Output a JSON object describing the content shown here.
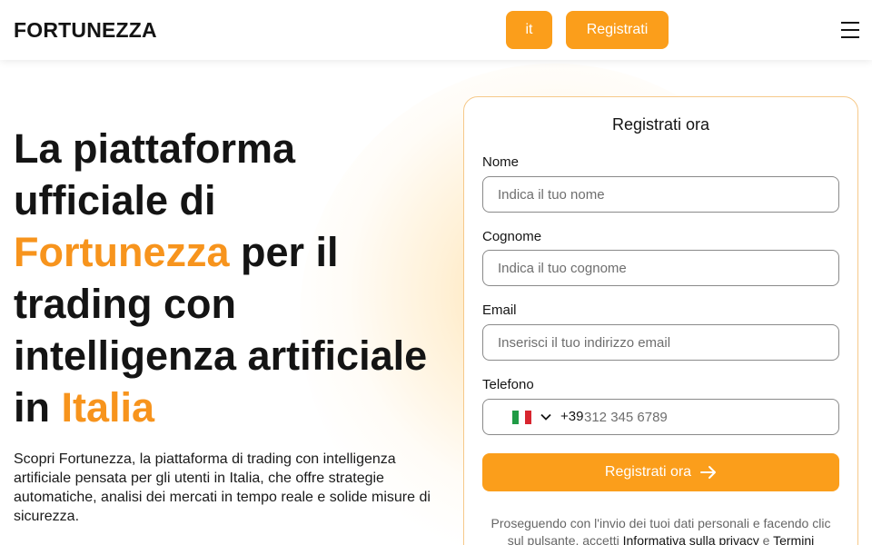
{
  "header": {
    "logo": "FORTUNEZZA",
    "lang_label": "it",
    "register_label": "Registrati",
    "menu_icon": "hamburger-menu-icon"
  },
  "hero": {
    "title_line1": "La piattaforma",
    "title_line2": "ufficiale di",
    "title_accent1": "Fortunezza",
    "title_line3_rest": " per il",
    "title_line4": "trading con",
    "title_line5": "intelligenza artificiale",
    "title_line6_start": "in ",
    "title_accent2": "Italia",
    "description": "Scopri Fortunezza, la piattaforma di trading con intelligenza artificiale pensata per gli utenti in Italia, che offre strategie automatiche, analisi dei mercati in tempo reale e solide misure di sicurezza."
  },
  "form": {
    "title": "Registrati ora",
    "first_name_label": "Nome",
    "first_name_placeholder": "Indica il tuo nome",
    "last_name_label": "Cognome",
    "last_name_placeholder": "Indica il tuo cognome",
    "email_label": "Email",
    "email_placeholder": "Inserisci il tuo indirizzo email",
    "phone_label": "Telefono",
    "phone_dial_code": "+39",
    "phone_placeholder": "312 345 6789",
    "phone_flag_icon": "italy-flag-icon",
    "submit_label": "Registrati ora",
    "consent_text": "Proseguendo con l'invio dei tuoi dati personali e facendo clic sul pulsante, accetti ",
    "privacy_link": "Informativa sulla privacy",
    "consent_and": " e ",
    "terms_link": "Termini"
  },
  "colors": {
    "accent": "#f7941d",
    "button": "#fb9e1b"
  }
}
